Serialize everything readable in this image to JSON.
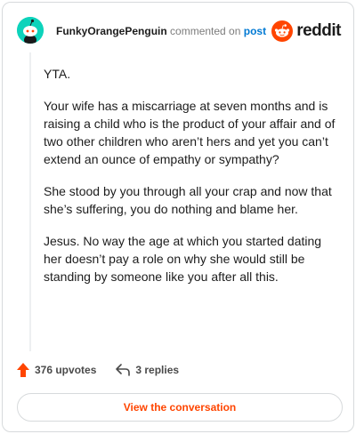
{
  "header": {
    "username": "FunkyOrangePenguin",
    "commented_text": "commented on",
    "post_link": "post",
    "logo_text": "reddit"
  },
  "comment": {
    "paragraphs": [
      "YTA.",
      "Your wife has a miscarriage at seven months and is raising a child who is the product of your affair and of two other children who aren’t hers and yet you can’t extend an ounce of empathy or sympathy?",
      "She stood by you through all your crap and now that she’s suffering, you do nothing and blame her.",
      "Jesus. No way the age at which you started dating her doesn’t pay a role on why she would still be standing by someone like you after all this."
    ]
  },
  "actions": {
    "upvotes": "376 upvotes",
    "replies": "3 replies"
  },
  "cta": {
    "label": "View the conversation"
  },
  "colors": {
    "accent": "#ff4500",
    "link": "#0079d3",
    "avatar": "#0dd3bb"
  }
}
